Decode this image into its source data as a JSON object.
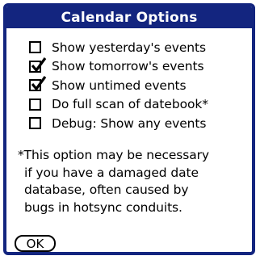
{
  "dialog": {
    "title": "Calendar Options"
  },
  "options": [
    {
      "label": "Show yesterday's events",
      "checked": false
    },
    {
      "label": "Show tomorrow's events",
      "checked": true
    },
    {
      "label": "Show untimed events",
      "checked": true
    },
    {
      "label": "Do full scan of datebook*",
      "checked": false
    },
    {
      "label": "Debug: Show any events",
      "checked": false
    }
  ],
  "note": {
    "lines": [
      "*This option may be necessary",
      "if you have a damaged date",
      "database, often caused by",
      "bugs in hotsync conduits."
    ]
  },
  "buttons": {
    "ok_label": "OK"
  },
  "colors": {
    "title_bar": "#13257f",
    "background": "#ffffff",
    "text": "#000000"
  }
}
